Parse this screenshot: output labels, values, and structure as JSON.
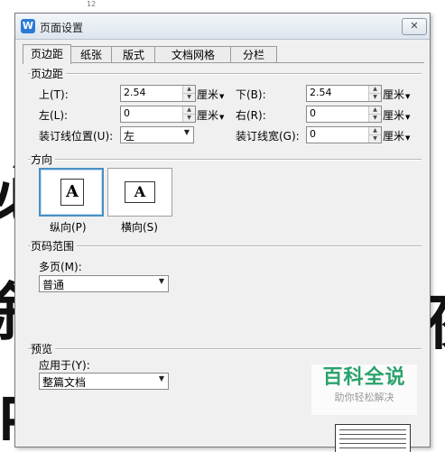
{
  "background": {
    "top_number": "12",
    "glyphs": [
      "必",
      "叙",
      "日",
      "夜"
    ]
  },
  "dialog": {
    "title": "页面设置",
    "app_icon_letter": "W",
    "close_label": "✕",
    "tabs": [
      {
        "label": "页边距",
        "active": true
      },
      {
        "label": "纸张",
        "active": false
      },
      {
        "label": "版式",
        "active": false
      },
      {
        "label": "文档网格",
        "active": false
      },
      {
        "label": "分栏",
        "active": false
      }
    ]
  },
  "margins": {
    "group_label": "页边距",
    "top": {
      "label": "上(T):",
      "value": "2.54",
      "unit": "厘米"
    },
    "bottom": {
      "label": "下(B):",
      "value": "2.54",
      "unit": "厘米"
    },
    "left": {
      "label": "左(L):",
      "value": "0",
      "unit": "厘米"
    },
    "right": {
      "label": "右(R):",
      "value": "0",
      "unit": "厘米"
    },
    "gutter_position": {
      "label": "装订线位置(U):",
      "value": "左"
    },
    "gutter": {
      "label": "装订线宽(G):",
      "value": "0",
      "unit": "厘米"
    }
  },
  "orientation": {
    "group_label": "方向",
    "portrait": {
      "label": "纵向(P)",
      "glyph": "A",
      "selected": true
    },
    "landscape": {
      "label": "横向(S)",
      "glyph": "A",
      "selected": false
    }
  },
  "pages": {
    "group_label": "页码范围",
    "multiple_label": "多页(M):",
    "multiple_value": "普通"
  },
  "preview": {
    "group_label": "预览",
    "apply_label": "应用于(Y):",
    "apply_value": "整篇文档"
  },
  "watermark": {
    "main": "百科全说",
    "sub": "助你轻松解决"
  },
  "colors": {
    "dialog_bg": "#f0f0f0",
    "selection_border": "#4a90c4",
    "watermark_green": "#2aa36c"
  }
}
